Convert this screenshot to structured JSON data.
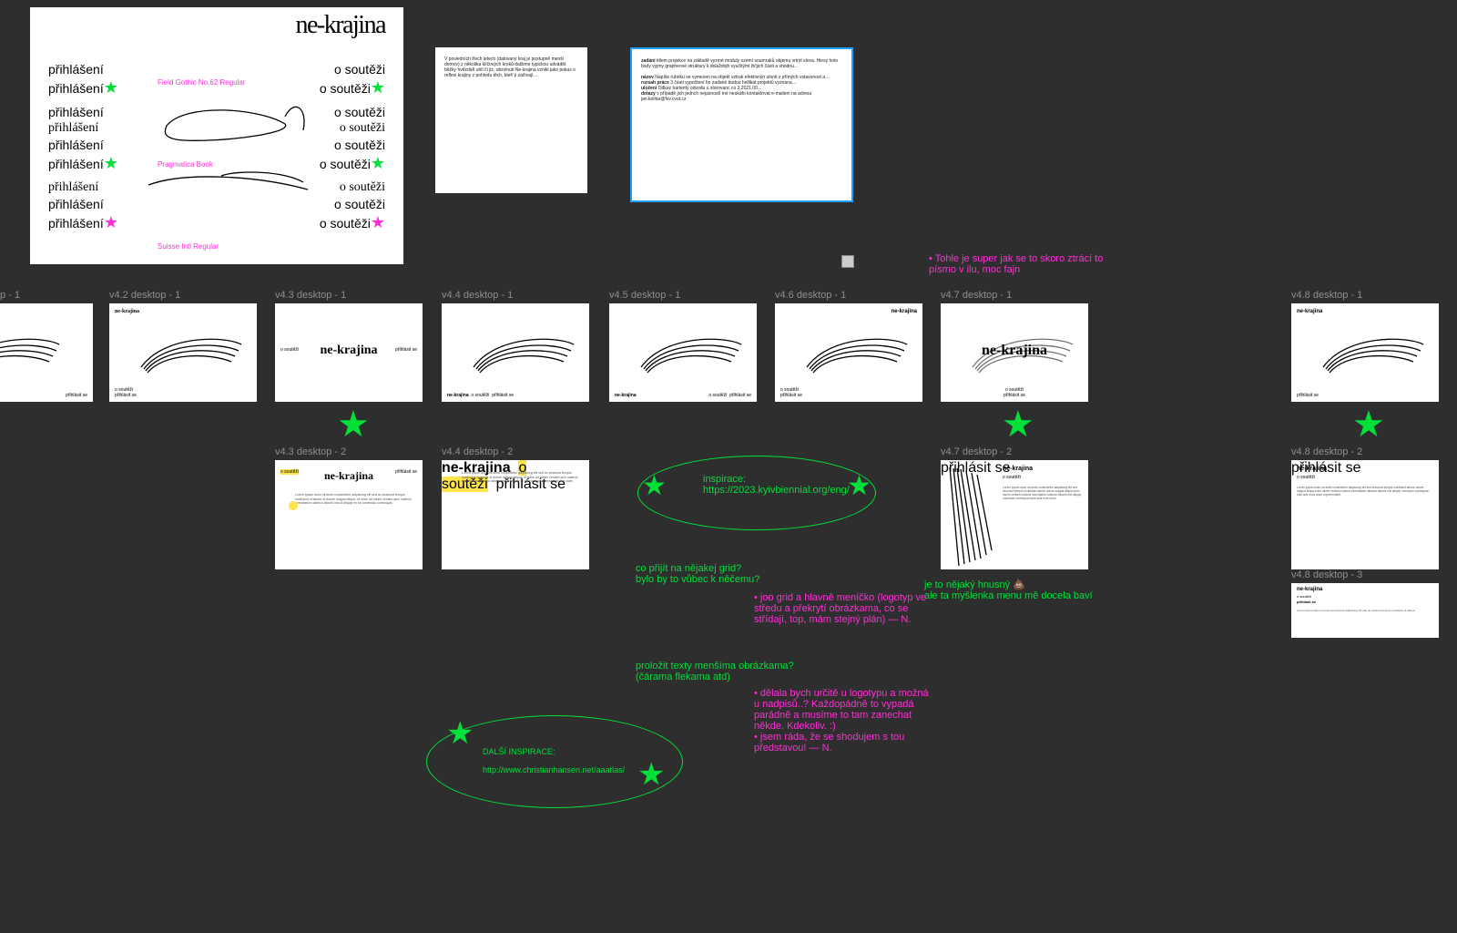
{
  "logo": "ne-krajina",
  "left_word": "přihlášení",
  "right_word": "o soutěži",
  "font_labels": {
    "a": "Field Gothic No.62 Regular",
    "b": "Pragmatica Book",
    "c": "Suisse Intl Regular"
  },
  "frame_labels": {
    "p1": "p - 1",
    "v42": "v4.2 desktop - 1",
    "v43": "v4.3 desktop - 1",
    "v44": "v4.4 desktop - 1",
    "v45": "v4.5 desktop - 1",
    "v46": "v4.6 desktop - 1",
    "v47": "v4.7 desktop - 1",
    "v48": "v4.8 desktop - 1",
    "v43b": "v4.3 desktop - 2",
    "v44b": "v4.4 desktop - 2",
    "v47b": "v4.7 desktop - 2",
    "v48b": "v4.8 desktop - 2",
    "v48c": "v4.8 desktop - 3"
  },
  "thumb_text": {
    "title": "ne-krajina",
    "link1": "o soutěži",
    "link2": "přihlásit se"
  },
  "notes": {
    "top_pink": "Tohle je super jak se to skoro ztrácí to písmo v ilu, moc fajn",
    "insp_label": "inspirace:",
    "insp_url": "https://2023.kyivbiennial.org/eng/",
    "jeto": "je to nějaký hnusný 💩\nale ta myšlenka menu mě docela baví",
    "grid_q": "co přijít na nějakej grid?\nbylo by to vůbec k něčemu?",
    "grid_a": "joo grid a hlavně meníčko (logotyp ve středu a překrytí obrázkama, co se střídají, top, mám stejný plán) — N.",
    "imgs_q": "proložit texty menšíma obrázkama?\n(čárama flekama atd)",
    "imgs_a1": "dělala bych určitě u logotypu a možná u nadpisů..? Každopádně to vypadá parádně a musíme to tam zanechat někde. Kdekoliv. :)",
    "imgs_a2": "jsem ráda, že se shodujem s tou představou! — N.",
    "dals_label": "DALŠÍ INSPIRACE:",
    "dals_url": "http://www.christianhansen.net/aaatlas/"
  },
  "panel1_head": "",
  "panel2_head": "zadání"
}
